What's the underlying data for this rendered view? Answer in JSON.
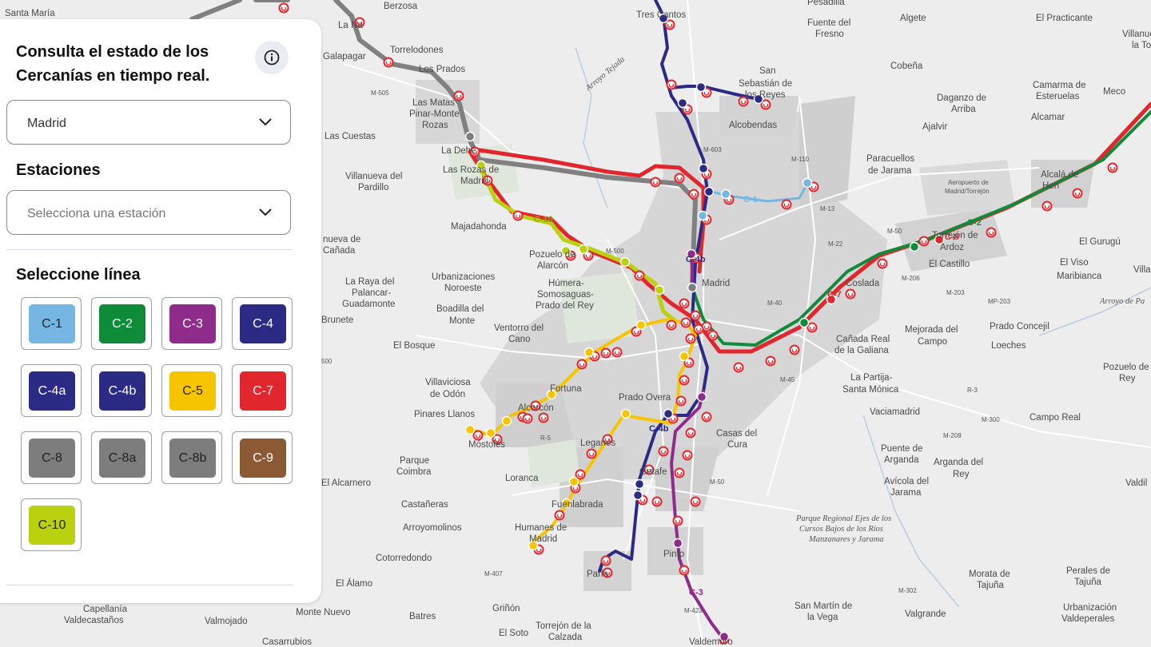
{
  "panel": {
    "title_line1": "Consulta el estado de los",
    "title_line2": "Cercanías en tiempo real.",
    "region_select": {
      "value": "Madrid"
    },
    "stations": {
      "label": "Estaciones",
      "placeholder": "Selecciona una estación"
    },
    "lines_section": {
      "label": "Seleccione línea"
    }
  },
  "lines": [
    {
      "label": "C-1",
      "color": "#76b6e3",
      "text": "#222222"
    },
    {
      "label": "C-2",
      "color": "#0e8c3a",
      "text": "#ffffff"
    },
    {
      "label": "C-3",
      "color": "#8f2b8a",
      "text": "#ffffff"
    },
    {
      "label": "C-4",
      "color": "#2b2b86",
      "text": "#ffffff"
    },
    {
      "label": "C-4a",
      "color": "#2b2b86",
      "text": "#ffffff"
    },
    {
      "label": "C-4b",
      "color": "#2b2b86",
      "text": "#ffffff"
    },
    {
      "label": "C-5",
      "color": "#f7c500",
      "text": "#222222"
    },
    {
      "label": "C-7",
      "color": "#e1262d",
      "text": "#ffffff"
    },
    {
      "label": "C-8",
      "color": "#7d7d7d",
      "text": "#222222"
    },
    {
      "label": "C-8a",
      "color": "#7d7d7d",
      "text": "#222222"
    },
    {
      "label": "C-8b",
      "color": "#7d7d7d",
      "text": "#222222"
    },
    {
      "label": "C-9",
      "color": "#8b5a35",
      "text": "#ffffff"
    },
    {
      "label": "C-10",
      "color": "#b9d10f",
      "text": "#222222"
    }
  ],
  "map": {
    "places": {
      "santa_maria": "Santa María",
      "berzosa": "Berzosa",
      "tres_cantos": "Tres Cantos",
      "pesadilla": "Pesadilla",
      "fuente_fresno_1": "Fuente del",
      "fuente_fresno_2": "Fresno",
      "algete": "Algete",
      "el_practicante": "El Practicante",
      "villanueva_la_1": "Villanue",
      "villanueva_la_2": "la To",
      "la_navata": "La Na",
      "torrelodones": "Torrelodones",
      "galapagar": "Galapagar",
      "los_prados": "Los Prados",
      "san_sebastian_1": "San",
      "san_sebastian_2": "Sebastián de",
      "san_sebastian_3": "los Reyes",
      "cobena": "Cobeña",
      "camarma_1": "Camarma de",
      "camarma_2": "Esteruelas",
      "meco": "Meco",
      "las_matas_1": "Las Matas",
      "las_matas_2": "Pinar-Monte",
      "las_matas_3": "Rozas",
      "daganzo_1": "Daganzo de",
      "daganzo_2": "Arriba",
      "alcobendas": "Alcobendas",
      "ajalvir": "Ajalvir",
      "alcamar": "Alcamar",
      "las_cuestas": "Las Cuestas",
      "la_dehesa": "La Dehe",
      "las_rozas_1": "Las Rozas de",
      "las_rozas_2": "Madrid",
      "paracuellos_1": "Paracuellos",
      "paracuellos_2": "de Jarama",
      "aeropuerto_1": "Aeropuerto de",
      "aeropuerto_2": "Madrid/Torrejón",
      "alcala_1": "Alcalá de",
      "alcala_2": "Hen",
      "villanueva_pardillo_1": "Villanueva del",
      "villanueva_pardillo_2": "Pardillo",
      "majadahonda": "Majadahonda",
      "villanueva_canada_1": "nueva de",
      "villanueva_canada_2": "Cañada",
      "pozuelo_1": "Pozuelo de",
      "pozuelo_2": "Alarcón",
      "torrejon_1": "Torrejón de",
      "torrejon_2": "Ardoz",
      "el_gurugu": "El Gurugú",
      "el_castillo": "El Castillo",
      "el_viso": "El Viso",
      "maribianca": "Maribianca",
      "villa_edge": "Villa",
      "urbanizaciones_1": "Urbanizaciones",
      "urbanizaciones_2": "Noroeste",
      "humera_1": "Húmera-",
      "humera_2": "Somosaguas-",
      "humera_3": "Prado del Rey",
      "madrid": "Madrid",
      "coslada": "Coslada",
      "la_raya_1": "La Raya del",
      "la_raya_2": "Palancar-",
      "la_raya_3": "Guadamonte",
      "boadilla_1": "Boadilla del",
      "boadilla_2": "Monte",
      "brunete": "Brunete",
      "ventorro_1": "Ventorro del",
      "ventorro_2": "Cano",
      "el_bosque": "El Bosque",
      "canada_real_1": "Cañada Real",
      "canada_real_2": "de la Galiana",
      "mejorada_1": "Mejorada del",
      "mejorada_2": "Campo",
      "prado_concejil": "Prado Concejil",
      "loeches": "Loeches",
      "pozuelo_rey_1": "Pozuelo de",
      "pozuelo_rey_2": "Rey",
      "villaviciosa_1": "Villaviciosa",
      "villaviciosa_2": "de Odón",
      "fortuna": "Fortuna",
      "la_partija_1": "La Partija-",
      "la_partija_2": "Santa Mónica",
      "pinares_llanos": "Pinares Llanos",
      "alcorcon": "Alcorcón",
      "prado_overa": "Prado Overa",
      "vaciamadrid": "Vaciamadrid",
      "campo_real": "Campo Real",
      "mostoles": "Móstoles",
      "leganes": "Leganés",
      "casas_cura_1": "Casas del",
      "casas_cura_2": "Cura",
      "parque_coimbra_1": "Parque",
      "parque_coimbra_2": "Coimbra",
      "puente_arganda_1": "Puente de",
      "puente_arganda_2": "Arganda",
      "arganda_1": "Arganda del",
      "arganda_2": "Rey",
      "valdilecha": "Valdil",
      "el_alcarnero": "El Alcarnero",
      "loranca": "Loranca",
      "getafe": "Getafe",
      "avicola_1": "Avícola del",
      "avicola_2": "Jarama",
      "castanferas": "Castañeras",
      "fuenlabrada": "Fuenlabrada",
      "arroyomolinos": "Arroyomolinos",
      "humanes_1": "Humanes de",
      "humanes_2": "Madrid",
      "cotorredondo": "Cotorredondo",
      "pinto": "Pinto",
      "el_alamo": "El Álamo",
      "parla": "Parla",
      "morata_1": "Morata de",
      "morata_2": "Tajuña",
      "perales_1": "Perales de",
      "perales_2": "Tajuña",
      "capellania_1": "Capellanía",
      "capellania_2": "Valdecastaños",
      "valmojado": "Valmojado",
      "monte_nuevo": "Monte Nuevo",
      "batres": "Batres",
      "grinon": "Griñón",
      "san_martin_1": "San Martín de",
      "san_martin_2": "la Vega",
      "valgrande": "Valgrande",
      "urb_valdeperales_1": "Urbanización",
      "urb_valdeperales_2": "Valdeperales",
      "el_soto": "El Soto",
      "torrejon_calzada_1": "Torrejón de la",
      "torrejon_calzada_2": "Calzada",
      "casarrubios": "Casarrubios",
      "valdemoro": "Valdemoro",
      "arroyo_tejada": "Arroyo Tejada",
      "arroyo_pantueña": "Arroyo de Pa",
      "parque_regional_1": "Parque Regional Ejes de los",
      "parque_regional_2": "Cursos Bajos de los Ríos",
      "parque_regional_3": "Manzanares y Jarama"
    },
    "roads": {
      "m505": "M-505",
      "m603": "M-603",
      "m110": "M-110",
      "m13": "M-13",
      "m50_ne": "M-50",
      "m22": "M-22",
      "m500": "M-500",
      "m206": "M-206",
      "m203": "M-203",
      "mp203": "MP-203",
      "m40": "M-40",
      "m45": "M-45",
      "r3": "R-3",
      "m300": "M-300",
      "m208": "M-208",
      "r5": "R-5",
      "m50_s": "M-50",
      "m407": "M-407",
      "m302": "M-302",
      "m423": "M-423",
      "m500b": "500"
    },
    "line_labels": {
      "c1": "C-1",
      "c2": "C-2",
      "c8": "C-8",
      "c7": "C-7",
      "c10": "C-10",
      "c4b": "C-4b",
      "c3": "C-3",
      "c5": "C-5",
      "c7b": "C-7"
    }
  }
}
